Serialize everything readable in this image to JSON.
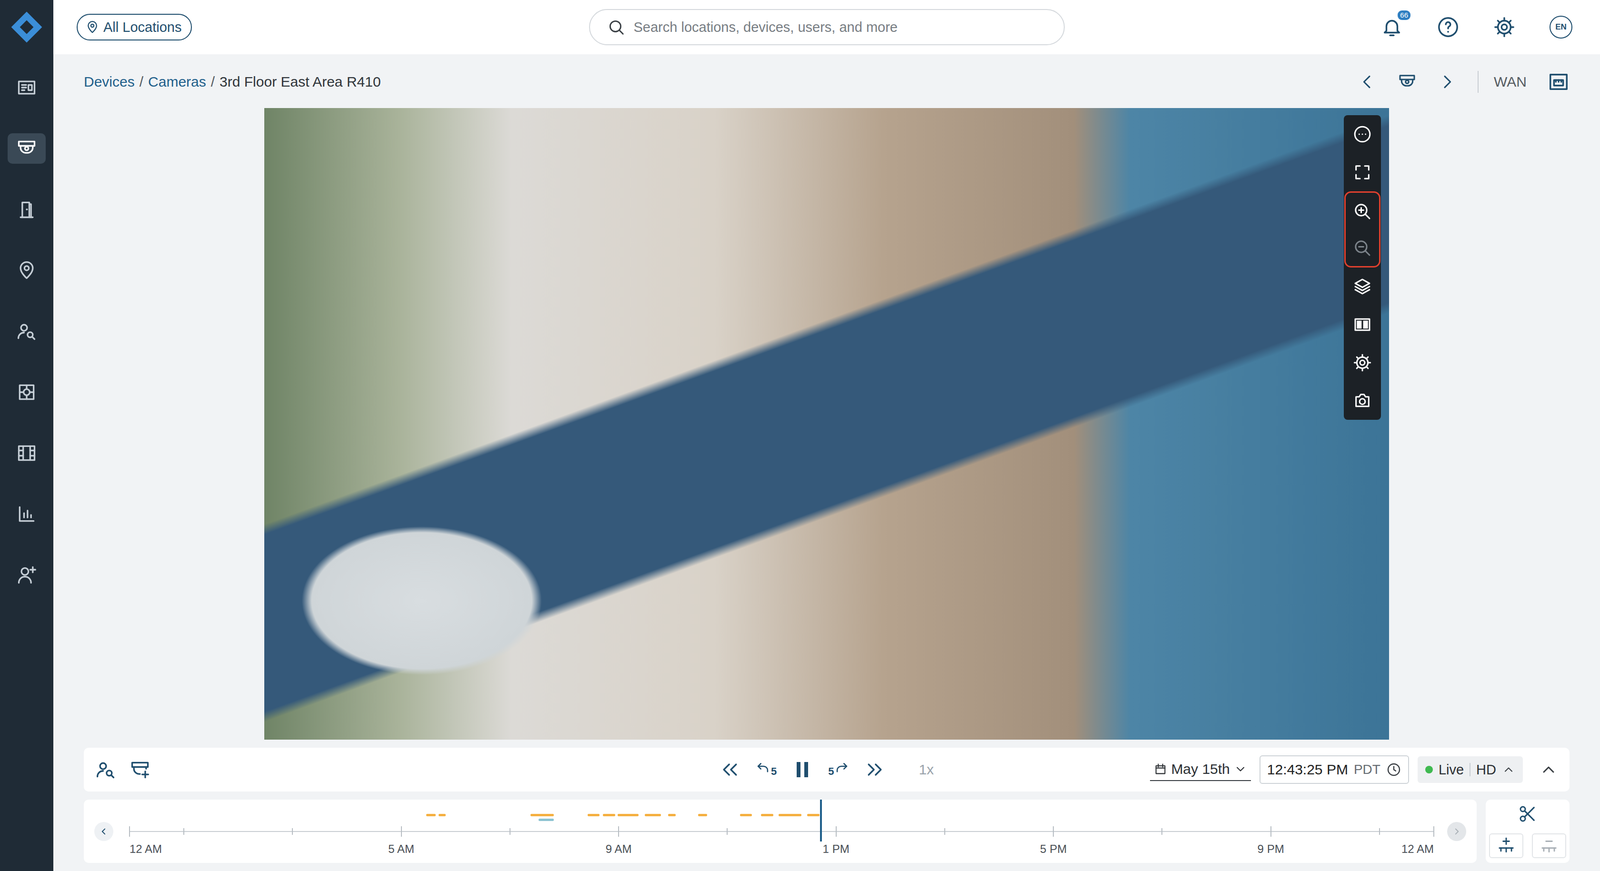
{
  "sidebar": {
    "items": [
      {
        "selected": false
      },
      {
        "selected": true
      },
      {
        "selected": false
      },
      {
        "selected": false
      },
      {
        "selected": false
      },
      {
        "selected": false
      },
      {
        "selected": false
      },
      {
        "selected": false
      },
      {
        "selected": false
      }
    ]
  },
  "topbar": {
    "location_button": "All Locations",
    "search": {
      "placeholder": "Search locations, devices, users, and more"
    },
    "notifications": {
      "count": "66"
    },
    "language": "EN"
  },
  "breadcrumb": {
    "separator": "/",
    "items": [
      {
        "label": "Devices",
        "link": true
      },
      {
        "label": "Cameras",
        "link": true
      },
      {
        "label": "3rd Floor East Area R410",
        "link": false
      }
    ]
  },
  "header_actions": {
    "network": "WAN"
  },
  "video": {
    "toolbar": [
      {
        "highlighted": false,
        "disabled": false
      },
      {
        "highlighted": false,
        "disabled": false
      },
      {
        "highlighted": true,
        "disabled": false
      },
      {
        "highlighted": true,
        "disabled": true
      },
      {
        "highlighted": false,
        "disabled": false
      },
      {
        "highlighted": false,
        "disabled": false
      },
      {
        "highlighted": false,
        "disabled": false
      },
      {
        "highlighted": false,
        "disabled": false
      }
    ]
  },
  "controls": {
    "skip_back": "5",
    "skip_forward": "5",
    "playing": true,
    "speed": {
      "label": "1x",
      "disabled": true
    },
    "date": "May 15th",
    "time": "12:43:25 PM",
    "timezone": "PDT",
    "status": {
      "label": "Live",
      "color": "#3fb950"
    },
    "quality": "HD"
  },
  "timeline": {
    "labels": [
      {
        "text": "12 AM",
        "hour": 0
      },
      {
        "text": "5 AM",
        "hour": 5
      },
      {
        "text": "9 AM",
        "hour": 9
      },
      {
        "text": "1 PM",
        "hour": 13
      },
      {
        "text": "5 PM",
        "hour": 17
      },
      {
        "text": "9 PM",
        "hour": 21
      },
      {
        "text": "12 AM",
        "hour": 24
      }
    ],
    "minor_ticks": [
      1,
      3,
      7,
      11,
      15,
      19,
      23
    ],
    "events": [
      {
        "start": 5.46,
        "end": 5.63,
        "lane": 0,
        "color": "#f5b041"
      },
      {
        "start": 5.69,
        "end": 5.82,
        "lane": 0,
        "color": "#f5b041"
      },
      {
        "start": 7.38,
        "end": 7.81,
        "lane": 0,
        "color": "#f5b041"
      },
      {
        "start": 7.53,
        "end": 7.81,
        "lane": 1,
        "color": "#8cc3d1"
      },
      {
        "start": 8.43,
        "end": 8.65,
        "lane": 0,
        "color": "#f5b041"
      },
      {
        "start": 8.71,
        "end": 8.94,
        "lane": 0,
        "color": "#f5b041"
      },
      {
        "start": 8.98,
        "end": 9.37,
        "lane": 0,
        "color": "#f5b041"
      },
      {
        "start": 9.48,
        "end": 9.78,
        "lane": 0,
        "color": "#f5b041"
      },
      {
        "start": 9.91,
        "end": 10.05,
        "lane": 0,
        "color": "#f5b041"
      },
      {
        "start": 10.46,
        "end": 10.63,
        "lane": 0,
        "color": "#f5b041"
      },
      {
        "start": 11.23,
        "end": 11.45,
        "lane": 0,
        "color": "#f5b041"
      },
      {
        "start": 11.62,
        "end": 11.85,
        "lane": 0,
        "color": "#f5b041"
      },
      {
        "start": 11.94,
        "end": 12.36,
        "lane": 0,
        "color": "#f5b041"
      },
      {
        "start": 12.47,
        "end": 12.7,
        "lane": 0,
        "color": "#f5b041"
      }
    ],
    "playhead": 12.72,
    "prev_disabled": false,
    "next_disabled": true,
    "zoom_out_disabled": true
  }
}
